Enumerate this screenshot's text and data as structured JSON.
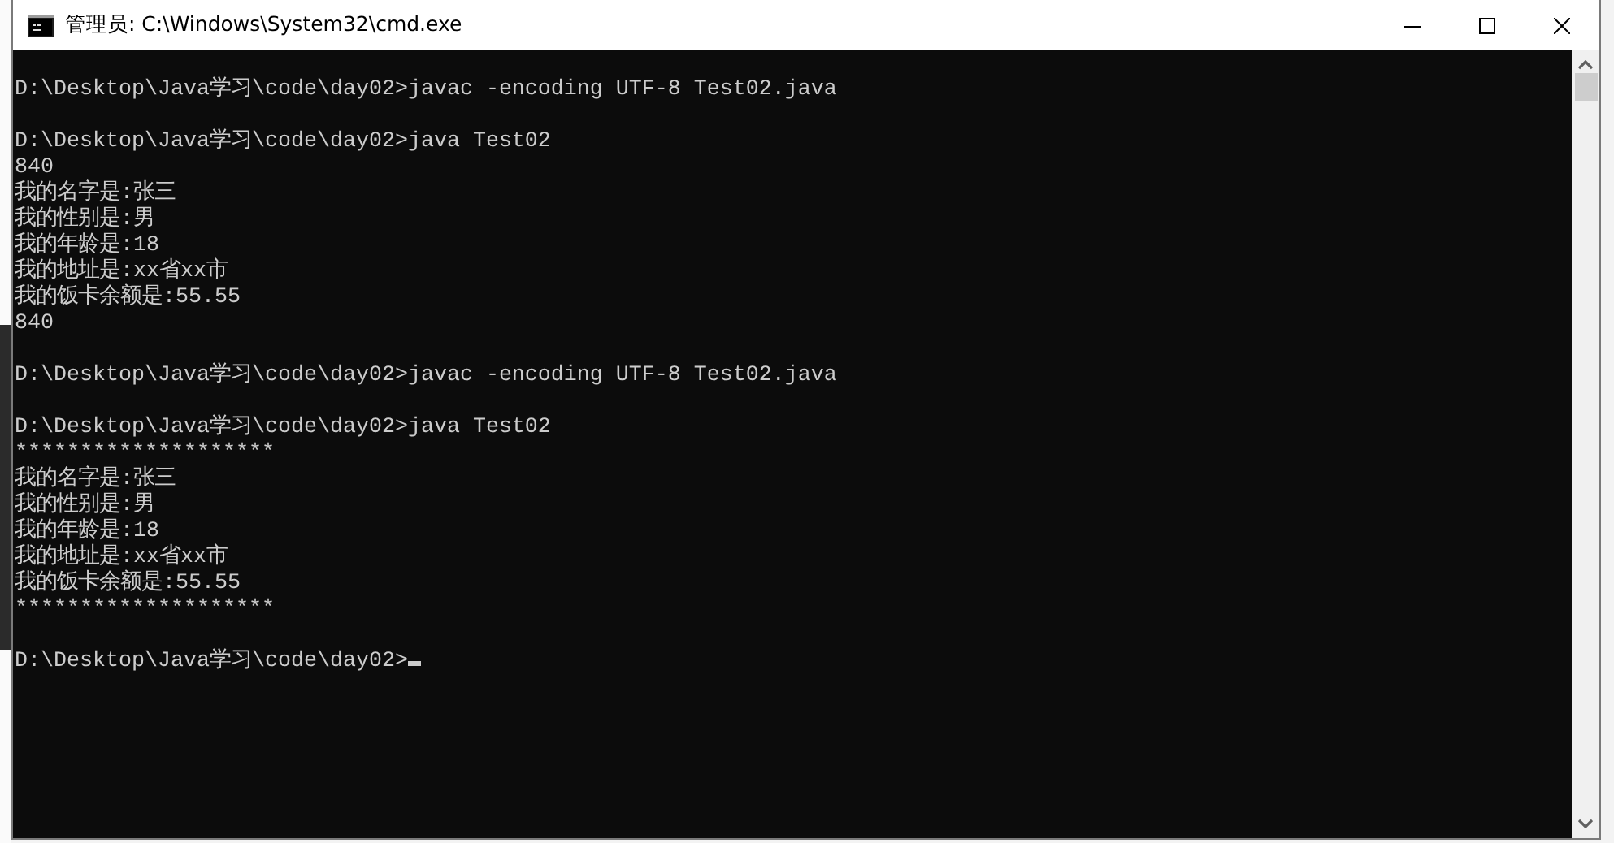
{
  "window": {
    "title": "管理员: C:\\Windows\\System32\\cmd.exe"
  },
  "console": {
    "blocks": [
      [
        "D:\\Desktop\\Java学习\\code\\day02>javac -encoding UTF-8 Test02.java"
      ],
      [
        "D:\\Desktop\\Java学习\\code\\day02>java Test02",
        "840",
        "我的名字是:张三",
        "我的性别是:男",
        "我的年龄是:18",
        "我的地址是:xx省xx市",
        "我的饭卡余额是:55.55",
        "840"
      ],
      [
        "D:\\Desktop\\Java学习\\code\\day02>javac -encoding UTF-8 Test02.java"
      ],
      [
        "D:\\Desktop\\Java学习\\code\\day02>java Test02",
        "********************",
        "我的名字是:张三",
        "我的性别是:男",
        "我的年龄是:18",
        "我的地址是:xx省xx市",
        "我的饭卡余额是:55.55",
        "********************"
      ],
      [
        "D:\\Desktop\\Java学习\\code\\day02>"
      ]
    ],
    "cursor": true
  }
}
